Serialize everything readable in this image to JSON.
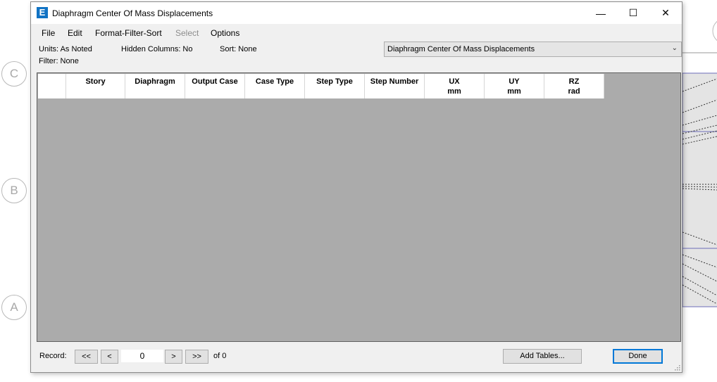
{
  "background": {
    "grid_bubbles": [
      "C",
      "B",
      "A"
    ]
  },
  "dialog": {
    "app_icon": "E",
    "title": "Diaphragm Center Of Mass Displacements",
    "window_controls": {
      "minimize": "—",
      "maximize": "☐",
      "close": "✕"
    },
    "menu": [
      "File",
      "Edit",
      "Format-Filter-Sort",
      "Select",
      "Options"
    ],
    "info": {
      "units": "Units:  As Noted",
      "hidden_columns": "Hidden Columns:  No",
      "sort": "Sort:  None",
      "filter": "Filter:  None"
    },
    "table_select": {
      "value": "Diaphragm Center Of Mass Displacements",
      "arrow": "⌄"
    },
    "columns": [
      {
        "l1": "Story",
        "l2": ""
      },
      {
        "l1": "Diaphragm",
        "l2": ""
      },
      {
        "l1": "Output Case",
        "l2": ""
      },
      {
        "l1": "Case Type",
        "l2": ""
      },
      {
        "l1": "Step Type",
        "l2": ""
      },
      {
        "l1": "Step Number",
        "l2": ""
      },
      {
        "l1": "UX",
        "l2": "mm"
      },
      {
        "l1": "UY",
        "l2": "mm"
      },
      {
        "l1": "RZ",
        "l2": "rad"
      }
    ],
    "footer": {
      "record_label": "Record:",
      "first": "<<",
      "prev": "<",
      "record_value": "0",
      "next": ">",
      "last": ">>",
      "of_total": "of 0",
      "add_tables": "Add Tables...",
      "done": "Done"
    }
  }
}
